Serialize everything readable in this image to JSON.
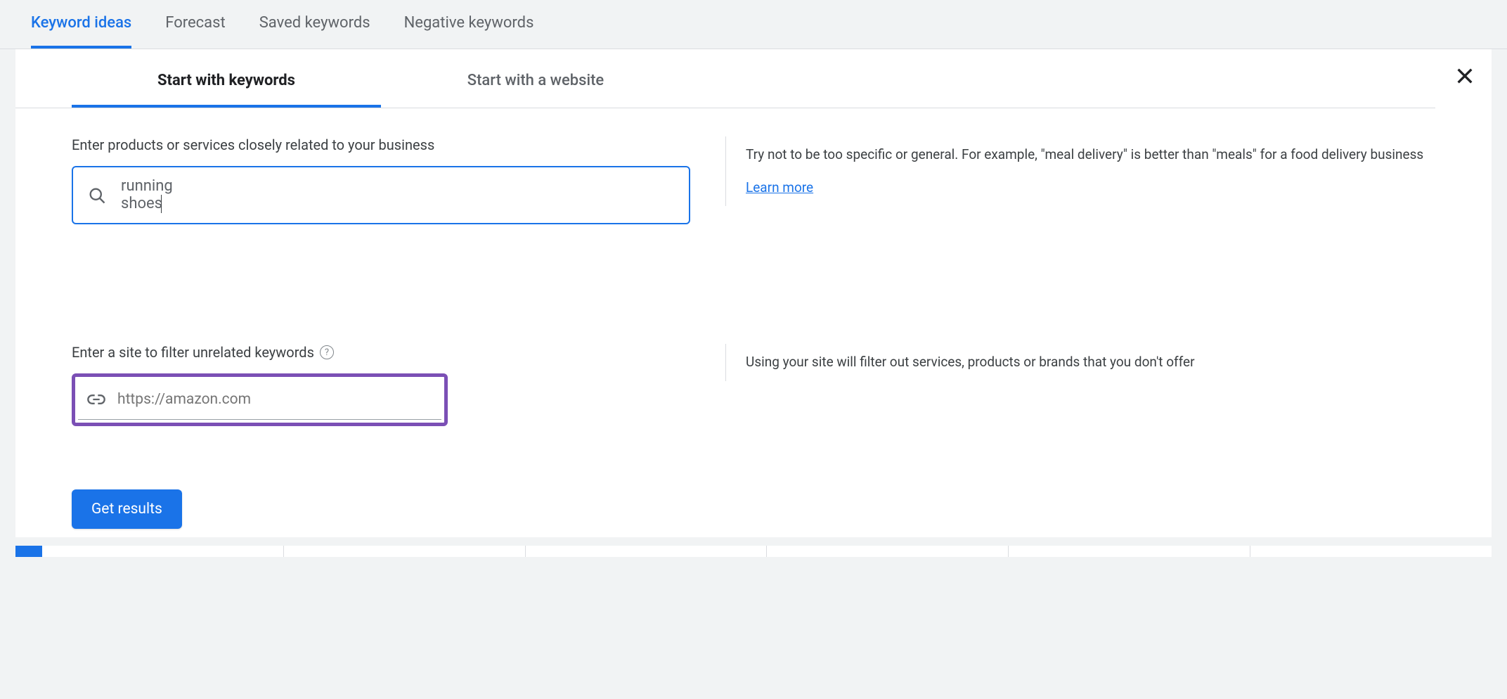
{
  "topNav": {
    "items": [
      {
        "label": "Keyword ideas",
        "active": true
      },
      {
        "label": "Forecast",
        "active": false
      },
      {
        "label": "Saved keywords",
        "active": false
      },
      {
        "label": "Negative keywords",
        "active": false
      }
    ]
  },
  "innerTabs": [
    {
      "label": "Start with keywords",
      "active": true
    },
    {
      "label": "Start with a website",
      "active": false
    }
  ],
  "keywordsSection": {
    "label": "Enter products or services closely related to your business",
    "value": "running shoes",
    "tip": "Try not to be too specific or general. For example, \"meal delivery\" is better than \"meals\" for a food delivery business",
    "learnMore": "Learn more"
  },
  "siteSection": {
    "label": "Enter a site to filter unrelated keywords",
    "placeholder": "https://amazon.com",
    "tip": "Using your site will filter out services, products or brands that you don't offer"
  },
  "actions": {
    "getResults": "Get results"
  }
}
